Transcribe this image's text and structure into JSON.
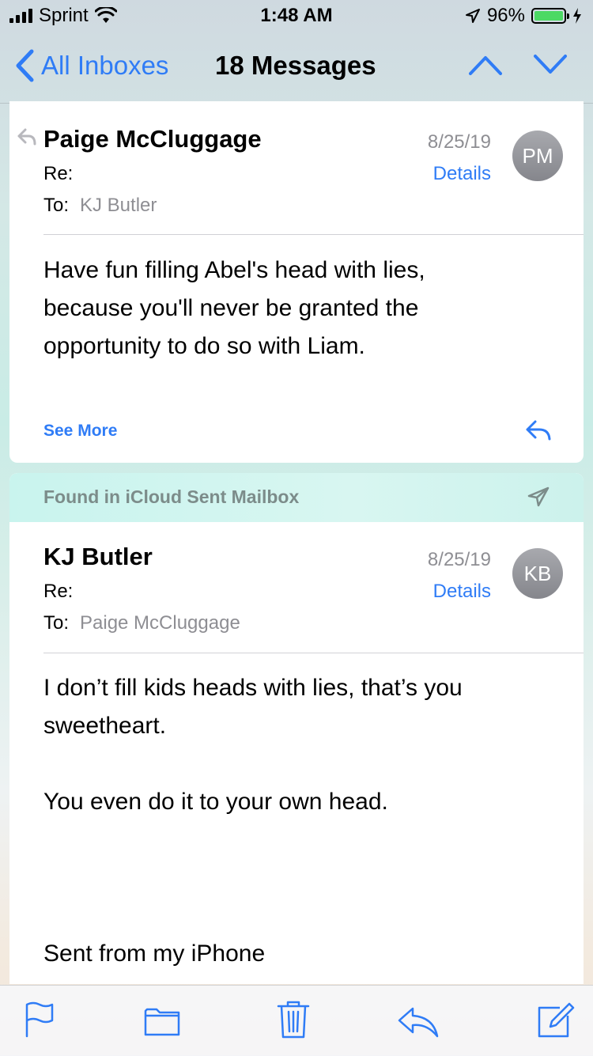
{
  "status_bar": {
    "carrier": "Sprint",
    "time": "1:48 AM",
    "battery_percent": "96%"
  },
  "nav": {
    "back_label": "All Inboxes",
    "title": "18 Messages"
  },
  "messages": [
    {
      "sender": "Paige McCluggage",
      "subject_label": "Re:",
      "to_label": "To:",
      "to_value": "KJ Butler",
      "date": "8/25/19",
      "details_label": "Details",
      "avatar_initials": "PM",
      "body": [
        "Have fun filling Abel's head with lies,",
        "because you'll never be granted the",
        "opportunity to do so with Liam."
      ],
      "see_more_label": "See More"
    },
    {
      "found_in_label": "Found in iCloud Sent Mailbox",
      "sender": "KJ Butler",
      "subject_label": "Re:",
      "to_label": "To:",
      "to_value": "Paige McCluggage",
      "date": "8/25/19",
      "details_label": "Details",
      "avatar_initials": "KB",
      "body": [
        "I don’t fill kids heads with lies, that’s you",
        "sweetheart.",
        "You even do it to your own head.",
        "Sent from my iPhone"
      ]
    }
  ],
  "toolbar": {
    "icons": [
      "flag-icon",
      "folder-icon",
      "trash-icon",
      "reply-icon",
      "compose-icon"
    ]
  },
  "colors": {
    "accent": "#2f7cf6",
    "battery": "#4cd964",
    "secondary_text": "#8e8e93"
  }
}
